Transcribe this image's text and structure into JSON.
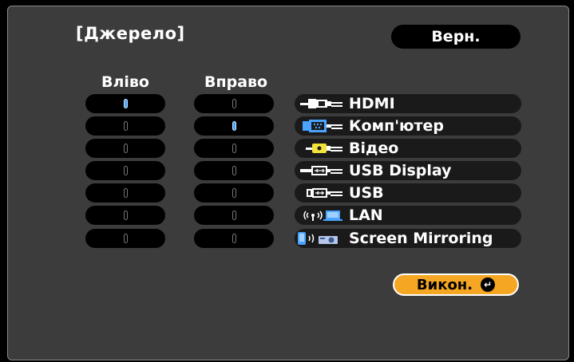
{
  "title": "[Джерело]",
  "buttons": {
    "back": "Верн.",
    "execute": "Викон."
  },
  "columns": {
    "left": "Вліво",
    "right": "Вправо"
  },
  "sources": [
    {
      "label": "HDMI",
      "icon": "hdmi-icon"
    },
    {
      "label": "Комп'ютер",
      "icon": "computer-vga-icon"
    },
    {
      "label": "Відео",
      "icon": "video-rca-icon"
    },
    {
      "label": "USB Display",
      "icon": "usb-display-icon"
    },
    {
      "label": "USB",
      "icon": "usb-icon"
    },
    {
      "label": "LAN",
      "icon": "lan-icon"
    },
    {
      "label": "Screen Mirroring",
      "icon": "screen-mirroring-icon"
    }
  ],
  "selection": {
    "left": "HDMI",
    "right": "Комп'ютер"
  },
  "colors": {
    "panel": "#3c3c3c",
    "accent": "#f5a623",
    "indicator_on": "#4aa3ff"
  }
}
